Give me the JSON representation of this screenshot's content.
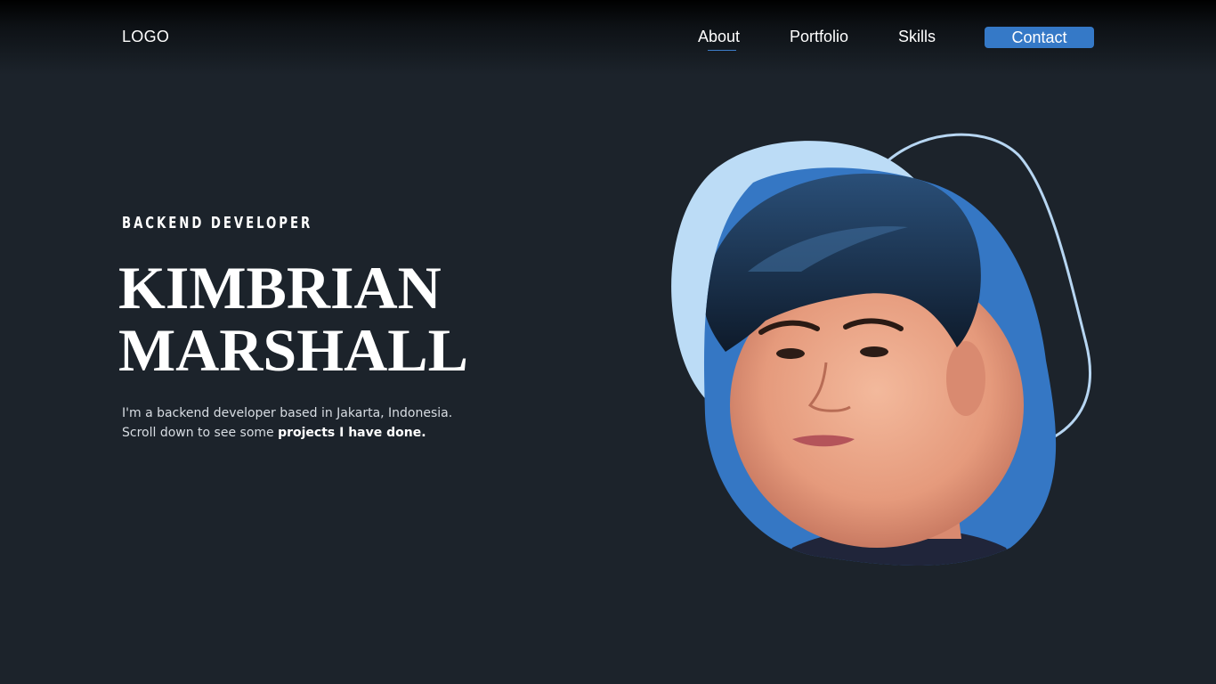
{
  "header": {
    "logo": "LOGO",
    "nav": {
      "about": "About",
      "portfolio": "Portfolio",
      "skills": "Skills",
      "contact": "Contact"
    },
    "active_nav": "About"
  },
  "hero": {
    "role": "BACKEND DEVELOPER",
    "name_line1": "KIMBRIAN",
    "name_line2": "MARSHALL",
    "intro_line1": "I'm a backend developer based in Jakarta, Indonesia.",
    "intro_line2_prefix": "Scroll down to see some ",
    "intro_line2_bold": "projects I have done."
  },
  "colors": {
    "background": "#1c232b",
    "accent": "#3579c7",
    "light_blob": "#bcdcf6",
    "outline": "#b7d6f2"
  },
  "portrait": {
    "icon": "profile-photo"
  }
}
